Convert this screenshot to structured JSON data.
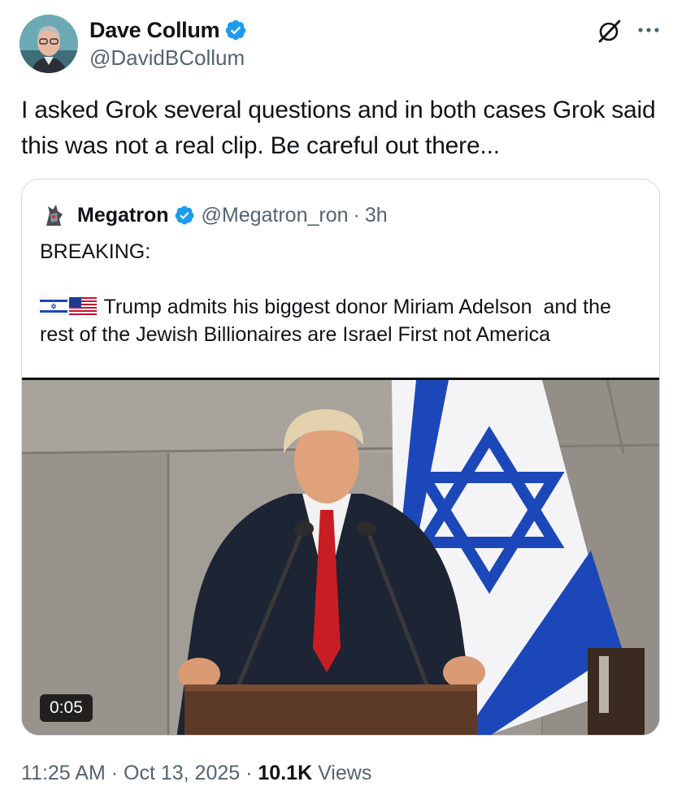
{
  "tweet": {
    "author_name": "Dave Collum",
    "author_handle": "@DavidBCollum",
    "text": "I asked Grok several questions and in both cases Grok said this was not a real clip. Be careful out there...",
    "time": "11:25 AM",
    "date": "Oct 13, 2025",
    "views_count": "10.1K",
    "views_label": "Views",
    "separator": "·"
  },
  "quoted": {
    "author_name": "Megatron",
    "author_handle": "@Megatron_ron",
    "age": "3h",
    "line1": "BREAKING:",
    "body": "Trump admits his biggest donor Miriam Adelson  and the rest of the Jewish Billionaires are Israel First not America",
    "video_duration": "0:05"
  },
  "icons": {
    "verified": "verified-badge-icon",
    "grok": "grok-icon",
    "more": "more-icon",
    "flags": [
      "israel-flag-icon",
      "us-flag-icon"
    ]
  },
  "colors": {
    "verified": "#1d9bf0",
    "text_primary": "#0f1419",
    "text_secondary": "#536471",
    "border": "#cfd9de",
    "flag_blue": "#1c47b8"
  }
}
